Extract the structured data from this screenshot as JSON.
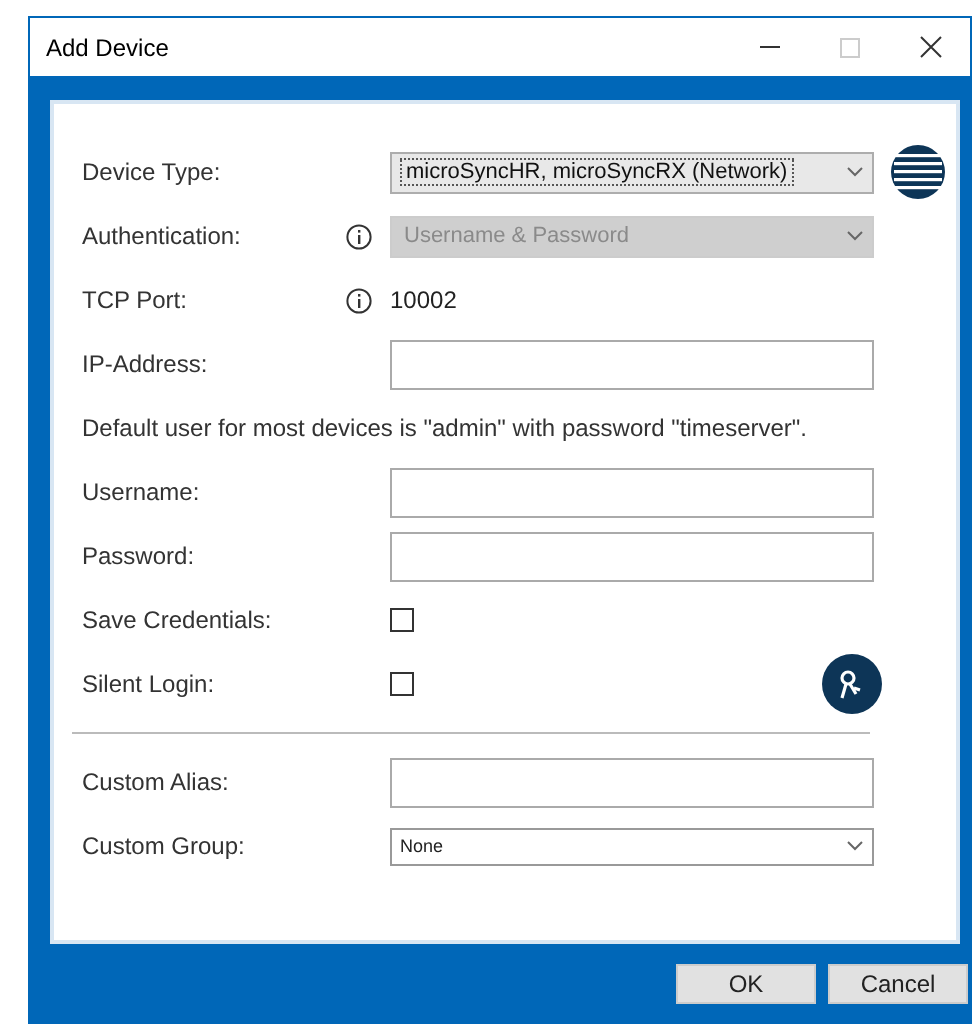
{
  "window": {
    "title": "Add Device"
  },
  "fields": [
    {
      "kind": "select",
      "label": "Device Type:",
      "value": "microSyncHR, microSyncRX (Network)",
      "disabled": false,
      "info": false
    },
    {
      "kind": "select",
      "label": "Authentication:",
      "value": "Username & Password",
      "disabled": true,
      "info": true
    },
    {
      "kind": "text",
      "label": "TCP Port:",
      "value": "10002",
      "info": true
    },
    {
      "kind": "input",
      "label": "IP-Address:"
    },
    {
      "kind": "note",
      "label": "Default user for most devices is \"admin\" with password \"timeserver\"."
    },
    {
      "kind": "input",
      "label": "Username:"
    },
    {
      "kind": "input",
      "label": "Password:"
    },
    {
      "kind": "checkbox",
      "label": "Save Credentials:",
      "checked": false
    },
    {
      "kind": "checkbox",
      "label": "Silent Login:",
      "checked": false
    }
  ],
  "custom_fields": [
    {
      "kind": "input",
      "label": "Custom Alias:"
    },
    {
      "kind": "small-select",
      "label": "Custom Group:",
      "value": "None",
      "disabled": false
    }
  ],
  "buttons": [
    {
      "label": "OK"
    },
    {
      "label": "Cancel"
    }
  ]
}
